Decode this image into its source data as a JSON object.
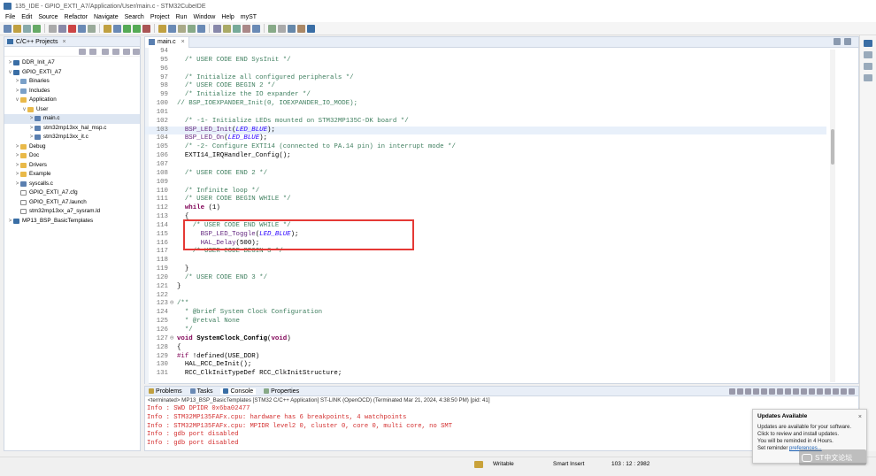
{
  "window": {
    "title": "135_IDE - GPIO_EXTI_A7/Application/User/main.c - STM32CubeIDE"
  },
  "menu": [
    "File",
    "Edit",
    "Source",
    "Refactor",
    "Navigate",
    "Search",
    "Project",
    "Run",
    "Window",
    "Help",
    "myST"
  ],
  "explorer": {
    "tab": "C/C++ Projects",
    "tree": [
      {
        "label": "DDR_Init_A7",
        "depth": 0,
        "arrow": ">",
        "icon": "proj"
      },
      {
        "label": "GPIO_EXTI_A7",
        "depth": 0,
        "arrow": "v",
        "icon": "proj"
      },
      {
        "label": "Binaries",
        "depth": 1,
        "arrow": ">",
        "icon": "bin"
      },
      {
        "label": "Includes",
        "depth": 1,
        "arrow": ">",
        "icon": "bin"
      },
      {
        "label": "Application",
        "depth": 1,
        "arrow": "v",
        "icon": "fold"
      },
      {
        "label": "User",
        "depth": 2,
        "arrow": "v",
        "icon": "fold"
      },
      {
        "label": "main.c",
        "depth": 3,
        "arrow": ">",
        "icon": "cfile",
        "selected": true
      },
      {
        "label": "stm32mp13xx_hal_msp.c",
        "depth": 3,
        "arrow": ">",
        "icon": "cfile"
      },
      {
        "label": "stm32mp13xx_it.c",
        "depth": 3,
        "arrow": ">",
        "icon": "cfile"
      },
      {
        "label": "Debug",
        "depth": 1,
        "arrow": ">",
        "icon": "fold"
      },
      {
        "label": "Doc",
        "depth": 1,
        "arrow": ">",
        "icon": "fold"
      },
      {
        "label": "Drivers",
        "depth": 1,
        "arrow": ">",
        "icon": "fold"
      },
      {
        "label": "Example",
        "depth": 1,
        "arrow": ">",
        "icon": "fold"
      },
      {
        "label": "syscalls.c",
        "depth": 1,
        "arrow": ">",
        "icon": "cfile"
      },
      {
        "label": "GPIO_EXTI_A7.cfg",
        "depth": 1,
        "arrow": "",
        "icon": "file"
      },
      {
        "label": "GPIO_EXTI_A7.launch",
        "depth": 1,
        "arrow": "",
        "icon": "file"
      },
      {
        "label": "stm32mp13xx_a7_sysram.ld",
        "depth": 1,
        "arrow": "",
        "icon": "file"
      },
      {
        "label": "MP13_BSP_BasicTemplates",
        "depth": 0,
        "arrow": ">",
        "icon": "proj"
      }
    ]
  },
  "editor": {
    "tab": "main.c",
    "lines": [
      {
        "n": "94",
        "parts": []
      },
      {
        "n": "95",
        "parts": [
          [
            "c",
            "  /* USER CODE END SysInit */"
          ]
        ]
      },
      {
        "n": "96",
        "parts": []
      },
      {
        "n": "97",
        "parts": [
          [
            "c",
            "  /* Initialize all configured peripherals */"
          ]
        ]
      },
      {
        "n": "98",
        "parts": [
          [
            "c",
            "  /* USER CODE BEGIN 2 */"
          ]
        ]
      },
      {
        "n": "99",
        "parts": [
          [
            "c",
            "  /* Initialize the IO expander */"
          ]
        ]
      },
      {
        "n": "100",
        "parts": [
          [
            "c",
            "// BSP_IOEXPANDER_Init(0, IOEXPANDER_IO_MODE);"
          ]
        ]
      },
      {
        "n": "101",
        "parts": []
      },
      {
        "n": "102",
        "parts": [
          [
            "c",
            "  /* -1- Initialize LEDs mounted on STM32MP135C-DK board */"
          ]
        ]
      },
      {
        "n": "103",
        "parts": [
          [
            "m",
            "  BSP_LED_Init"
          ],
          [
            "n",
            "("
          ],
          [
            "p",
            "LED_BLUE"
          ],
          [
            "n",
            ");"
          ]
        ],
        "hl": true
      },
      {
        "n": "104",
        "parts": [
          [
            "m",
            "  BSP_LED_On"
          ],
          [
            "n",
            "("
          ],
          [
            "p",
            "LED_BLUE"
          ],
          [
            "n",
            ");"
          ]
        ]
      },
      {
        "n": "105",
        "parts": [
          [
            "c",
            "  /* -2- Configure EXTI14 (connected to PA.14 pin) in interrupt mode */"
          ]
        ]
      },
      {
        "n": "106",
        "parts": [
          [
            "n",
            "  EXTI14_IRQHandler_Config();"
          ]
        ]
      },
      {
        "n": "107",
        "parts": []
      },
      {
        "n": "108",
        "parts": [
          [
            "c",
            "  /* USER CODE END 2 */"
          ]
        ]
      },
      {
        "n": "109",
        "parts": []
      },
      {
        "n": "110",
        "parts": [
          [
            "c",
            "  /* Infinite loop */"
          ]
        ]
      },
      {
        "n": "111",
        "parts": [
          [
            "c",
            "  /* USER CODE BEGIN WHILE */"
          ]
        ]
      },
      {
        "n": "112",
        "parts": [
          [
            "k",
            "  while"
          ],
          [
            "n",
            " (1)"
          ]
        ]
      },
      {
        "n": "113",
        "parts": [
          [
            "n",
            "  {"
          ]
        ]
      },
      {
        "n": "114",
        "parts": [
          [
            "c",
            "    /* USER CODE END WHILE */"
          ]
        ]
      },
      {
        "n": "115",
        "parts": [
          [
            "m",
            "      BSP_LED_Toggle"
          ],
          [
            "n",
            "("
          ],
          [
            "p",
            "LED_BLUE"
          ],
          [
            "n",
            ");"
          ]
        ]
      },
      {
        "n": "116",
        "parts": [
          [
            "m",
            "      HAL_Delay"
          ],
          [
            "n",
            "(500);"
          ]
        ]
      },
      {
        "n": "117",
        "parts": [
          [
            "c",
            "    /* USER CODE BEGIN 3 */"
          ]
        ]
      },
      {
        "n": "118",
        "parts": []
      },
      {
        "n": "119",
        "parts": [
          [
            "n",
            "  }"
          ]
        ]
      },
      {
        "n": "120",
        "parts": [
          [
            "c",
            "  /* USER CODE END 3 */"
          ]
        ]
      },
      {
        "n": "121",
        "parts": [
          [
            "n",
            "}"
          ]
        ]
      },
      {
        "n": "122",
        "parts": []
      },
      {
        "n": "123",
        "parts": [
          [
            "c",
            "/**"
          ]
        ],
        "fold": "⊖"
      },
      {
        "n": "124",
        "parts": [
          [
            "c",
            "  * @brief System Clock Configuration"
          ]
        ]
      },
      {
        "n": "125",
        "parts": [
          [
            "c",
            "  * @retval None"
          ]
        ]
      },
      {
        "n": "126",
        "parts": [
          [
            "c",
            "  */"
          ]
        ]
      },
      {
        "n": "127",
        "parts": [
          [
            "k",
            "void"
          ],
          [
            "n",
            " "
          ],
          [
            "b",
            "SystemClock_Config"
          ],
          [
            "n",
            "("
          ],
          [
            "k",
            "void"
          ],
          [
            "n",
            ")"
          ]
        ],
        "fold": "⊖"
      },
      {
        "n": "128",
        "parts": [
          [
            "n",
            "{"
          ]
        ]
      },
      {
        "n": "129",
        "parts": [
          [
            "d",
            "#if"
          ],
          [
            "n",
            " !defined(USE_DDR)"
          ]
        ]
      },
      {
        "n": "130",
        "parts": [
          [
            "n",
            "  HAL_RCC_DeInit();"
          ]
        ]
      },
      {
        "n": "131",
        "parts": [
          [
            "n",
            "  RCC_ClkInitTypeDef RCC_ClkInitStructure;"
          ]
        ]
      }
    ]
  },
  "console": {
    "tabs": [
      "Problems",
      "Tasks",
      "Console",
      "Properties"
    ],
    "terminated": "<terminated> MP13_BSP_BasicTemplates [STM32 C/C++ Application] ST-LINK (OpenOCD) (Terminated Mar 21, 2024, 4:38:50 PM) [pid: 41]",
    "lines": [
      "Info : SWD DPIDR 0x6ba02477",
      "Info : STM32MP135FAFx.cpu: hardware has 6 breakpoints, 4 watchpoints",
      "Info : STM32MP135FAFx.cpu: MPIDR level2 0, cluster 0, core 0, multi core, no SMT",
      "Info : gdb port disabled",
      "Info : gdb port disabled"
    ]
  },
  "status": {
    "writable": "Writable",
    "insert": "Smart Insert",
    "position": "103 : 12 : 2982"
  },
  "notification": {
    "title": "Updates Available",
    "body1": "Updates are available for your software.",
    "body2": "Click to review and install updates.",
    "body3": "You will be reminded in 4 Hours.",
    "body4": "Set reminder",
    "link": "preferences..."
  },
  "watermark": "ST中文论坛"
}
